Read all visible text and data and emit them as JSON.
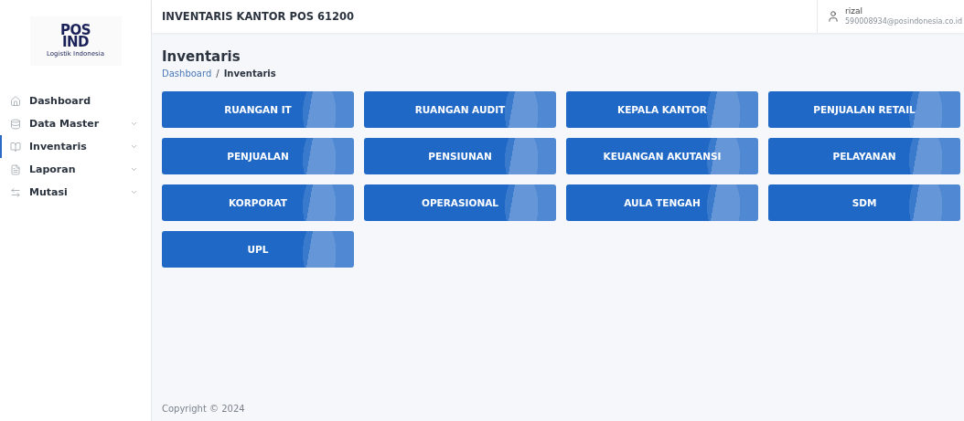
{
  "logo": {
    "line_1": "POS",
    "line_2": "IND",
    "tagline": "Logistik Indonesia"
  },
  "sidebar": {
    "items": [
      {
        "label": "Dashboard",
        "kind": "home",
        "expandable": false,
        "selected": false
      },
      {
        "label": "Data Master",
        "kind": "database",
        "expandable": true,
        "selected": false
      },
      {
        "label": "Inventaris",
        "kind": "book",
        "expandable": true,
        "selected": true
      },
      {
        "label": "Laporan",
        "kind": "file",
        "expandable": true,
        "selected": false
      },
      {
        "label": "Mutasi",
        "kind": "transfer",
        "expandable": true,
        "selected": false
      }
    ]
  },
  "header": {
    "title": "INVENTARIS KANTOR POS 61200",
    "user": {
      "name": "rizal",
      "email": "590008934@posindonesia.co.id"
    }
  },
  "page": {
    "title": "Inventaris",
    "breadcrumb_separator": "/",
    "breadcrumb": [
      {
        "label": "Dashboard",
        "selected": false
      },
      {
        "label": "Inventaris",
        "selected": true
      }
    ]
  },
  "rooms": [
    "RUANGAN IT",
    "RUANGAN AUDIT",
    "KEPALA KANTOR",
    "PENJUALAN RETAIL",
    "PENJUALAN",
    "PENSIUNAN",
    "KEUANGAN AKUTANSI",
    "PELAYANAN",
    "KORPORAT",
    "OPERASIONAL",
    "AULA TENGAH",
    "SDM",
    "UPL"
  ],
  "footer": "Copyright © 2024"
}
